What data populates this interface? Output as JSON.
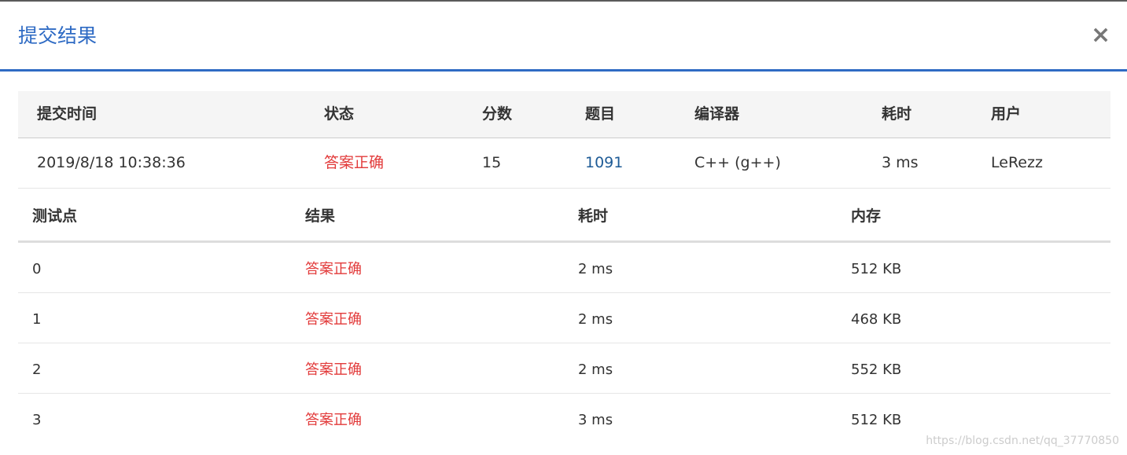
{
  "dialog": {
    "title": "提交结果",
    "close_label": "×"
  },
  "summary": {
    "headers": [
      "提交时间",
      "状态",
      "分数",
      "题目",
      "编译器",
      "耗时",
      "用户"
    ],
    "row": {
      "submit_time": "2019/8/18 10:38:36",
      "status": "答案正确",
      "score": "15",
      "problem": "1091",
      "compiler": "C++ (g++)",
      "time": "3 ms",
      "user": "LeRezz"
    }
  },
  "tests": {
    "headers": [
      "测试点",
      "结果",
      "耗时",
      "内存"
    ],
    "rows": [
      {
        "id": "0",
        "result": "答案正确",
        "time": "2 ms",
        "memory": "512 KB"
      },
      {
        "id": "1",
        "result": "答案正确",
        "time": "2 ms",
        "memory": "468 KB"
      },
      {
        "id": "2",
        "result": "答案正确",
        "time": "2 ms",
        "memory": "552 KB"
      },
      {
        "id": "3",
        "result": "答案正确",
        "time": "3 ms",
        "memory": "512 KB"
      }
    ]
  },
  "watermark": "https://blog.csdn.net/qq_37770850",
  "colors": {
    "accent": "#2f6bc4",
    "status_ok": "#e23a3a",
    "link": "#1e5b96"
  }
}
